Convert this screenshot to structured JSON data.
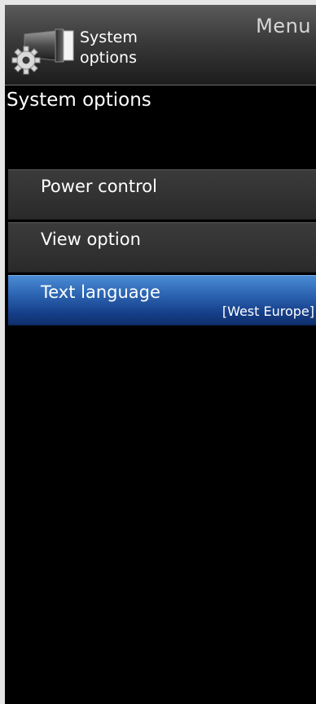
{
  "header": {
    "menu_label": "Menu",
    "title_line1": "System",
    "title_line2": "options",
    "icon": "gear-projector-icon"
  },
  "page": {
    "title": "System options"
  },
  "menu": {
    "items": [
      {
        "label": "Power control",
        "value": "",
        "selected": false
      },
      {
        "label": "View option",
        "value": "",
        "selected": false
      },
      {
        "label": "Text language",
        "value": "[West Europe]",
        "selected": true
      }
    ]
  },
  "colors": {
    "background": "#000000",
    "selected_blue": "#2b63b1",
    "item_gray": "#333333",
    "outer_frame": "#e6e6e6"
  }
}
